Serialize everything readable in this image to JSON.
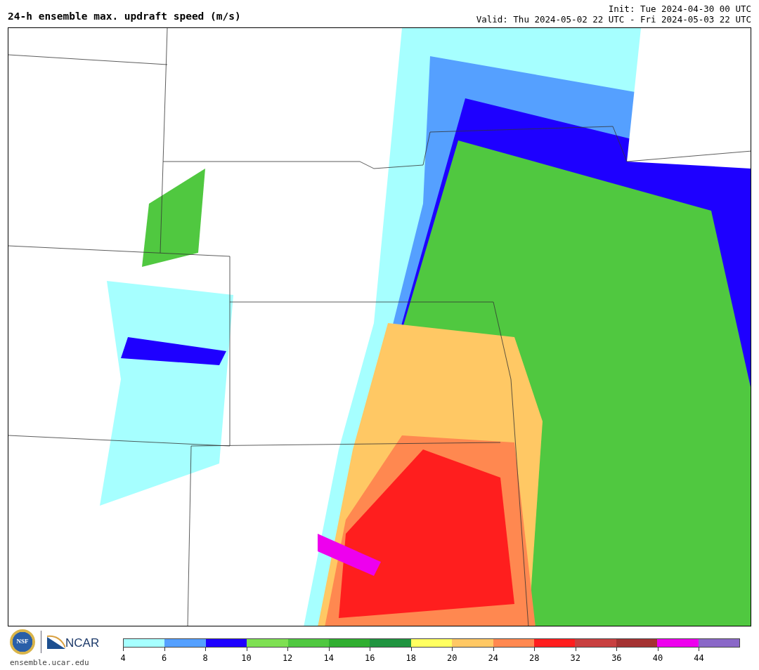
{
  "title": "24-h ensemble max. updraft speed (m/s)",
  "init": "Init: Tue 2024-04-30 00 UTC",
  "valid": "Valid: Thu 2024-05-02 22 UTC - Fri 2024-05-03 22 UTC",
  "logos": {
    "nsf": "NSF",
    "ncar": "NCAR",
    "site": "ensemble.ucar.edu"
  },
  "legend": [
    {
      "label": "4",
      "color": "#a6ffff"
    },
    {
      "label": "6",
      "color": "#55a0ff"
    },
    {
      "label": "8",
      "color": "#1e00ff"
    },
    {
      "label": "10",
      "color": "#7ee052"
    },
    {
      "label": "12",
      "color": "#50c840"
    },
    {
      "label": "14",
      "color": "#30ae30"
    },
    {
      "label": "16",
      "color": "#209440"
    },
    {
      "label": "18",
      "color": "#ffff60"
    },
    {
      "label": "20",
      "color": "#ffc864"
    },
    {
      "label": "24",
      "color": "#ff8850"
    },
    {
      "label": "28",
      "color": "#ff1e1e"
    },
    {
      "label": "32",
      "color": "#c84040"
    },
    {
      "label": "36",
      "color": "#a43232"
    },
    {
      "label": "40",
      "color": "#ee00ee"
    },
    {
      "label": "44",
      "color": "#8a68c8"
    }
  ]
}
